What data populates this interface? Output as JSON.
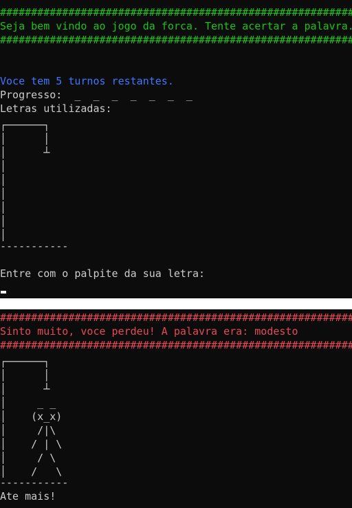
{
  "screen1": {
    "border_top": "###############################################################",
    "welcome": "Seja bem vindo ao jogo da forca. Tente acertar a palavra.",
    "border_bottom": "###############################################################",
    "turns": "Voce tem 5 turnos restantes.",
    "progress": "Progresso:  _  _  _  _  _  _  _",
    "letters_used": "Letras utilizadas:",
    "gallows_art": "┌──────┐\n│      │\n│      ┴\n│\n│\n│\n│\n│\n│",
    "ground": "-----------",
    "prompt": "Entre com o palpite da sua letra:"
  },
  "screen2": {
    "border_top": "##############################################################",
    "lose_message": "Sinto muito, voce perdeu! A palavra era: modesto",
    "border_bottom": "##############################################################",
    "gallows_art": "┌──────┐\n│      │\n│      ┴\n│     _ _\n│    (x_x)\n│     /|\\\n│    / | \\\n│     / \\\n│    /   \\",
    "ground": "-----------",
    "goodbye": "Ate mais!"
  },
  "colors": {
    "background": "#0c0c0c",
    "text": "#cccccc",
    "green": "#16c60c",
    "blue": "#3b78ff",
    "red": "#e74856",
    "separator": "#ffffff"
  }
}
